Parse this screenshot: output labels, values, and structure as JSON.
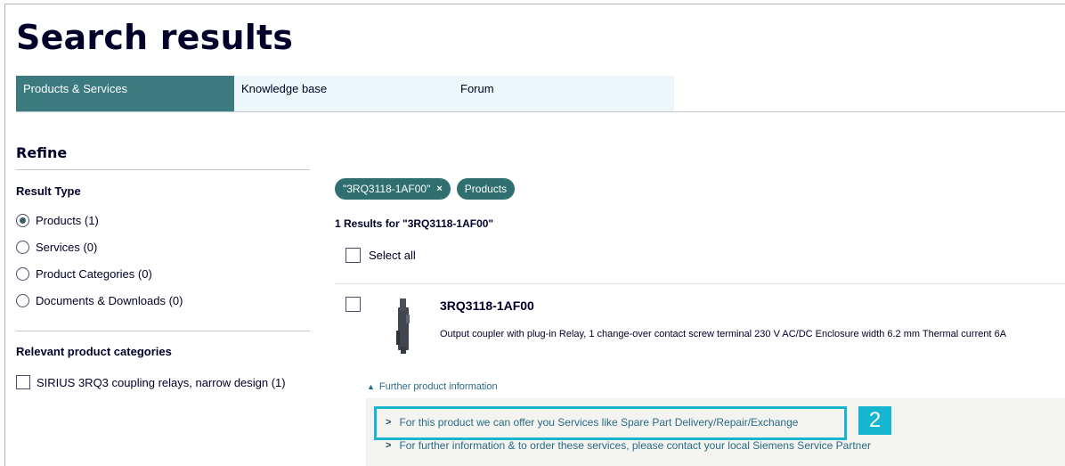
{
  "page": {
    "title": "Search results"
  },
  "tabs": [
    {
      "label": "Products & Services",
      "active": true
    },
    {
      "label": "Knowledge base",
      "active": false
    },
    {
      "label": "Forum",
      "active": false
    }
  ],
  "refine": {
    "title": "Refine",
    "result_type": {
      "title": "Result Type",
      "options": [
        {
          "label": "Products (1)",
          "checked": true
        },
        {
          "label": "Services (0)",
          "checked": false
        },
        {
          "label": "Product Categories (0)",
          "checked": false
        },
        {
          "label": "Documents & Downloads (0)",
          "checked": false
        }
      ]
    },
    "categories": {
      "title": "Relevant product categories",
      "items": [
        {
          "label": "SIRIUS 3RQ3 coupling relays, narrow design (1)",
          "checked": false
        }
      ]
    }
  },
  "filters": {
    "chips": [
      {
        "label": "\"3RQ3118-1AF00\"",
        "removable": true,
        "remove_glyph": "×"
      },
      {
        "label": "Products",
        "removable": false
      }
    ]
  },
  "results": {
    "count_text": "1 Results for \"3RQ3118-1AF00\"",
    "select_all_label": "Select all",
    "items": [
      {
        "name": "3RQ3118-1AF00",
        "description": "Output coupler with plug-in Relay, 1 change-over contact screw terminal 230 V AC/DC Enclosure width 6.2 mm Thermal current 6A",
        "further_info_label": "Further product information",
        "service_links": [
          "For this product we can offer you Services like Spare Part Delivery/Repair/Exchange",
          "For further information & to order these services, please contact your local Siemens Service Partner"
        ]
      }
    ]
  },
  "annotation": {
    "marker_label": "2",
    "color": "#16b6d0"
  },
  "colors": {
    "accent": "#3b7a7f",
    "tab_inactive_bg": "#ebf7f8",
    "chip_bg": "#2f6f6f",
    "link": "#2a6b86",
    "text": "#000028"
  }
}
